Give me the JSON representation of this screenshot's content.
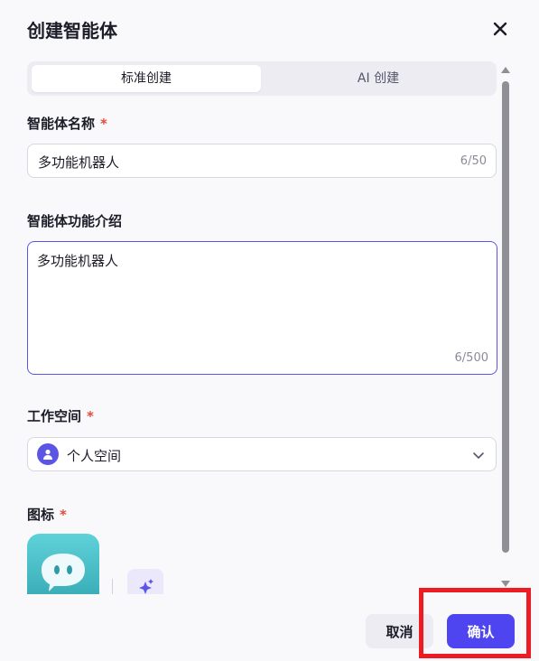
{
  "dialog": {
    "title": "创建智能体"
  },
  "tabs": [
    {
      "label": "标准创建",
      "active": true
    },
    {
      "label": "AI 创建",
      "active": false
    }
  ],
  "form": {
    "name": {
      "label": "智能体名称",
      "required_mark": "*",
      "value": "多功能机器人",
      "counter": "6/50"
    },
    "description": {
      "label": "智能体功能介绍",
      "value": "多功能机器人",
      "counter": "6/500"
    },
    "workspace": {
      "label": "工作空间",
      "required_mark": "*",
      "value": "个人空间"
    },
    "icon": {
      "label": "图标",
      "required_mark": "*"
    }
  },
  "footer": {
    "cancel_label": "取消",
    "confirm_label": "确认"
  },
  "colors": {
    "accent": "#4f45f0",
    "required": "#e34a3b",
    "highlight": "#ee1b22"
  },
  "icons": [
    "close-icon",
    "user-icon",
    "chevron-down-icon",
    "chat-bot-icon",
    "sparkle-icon"
  ]
}
